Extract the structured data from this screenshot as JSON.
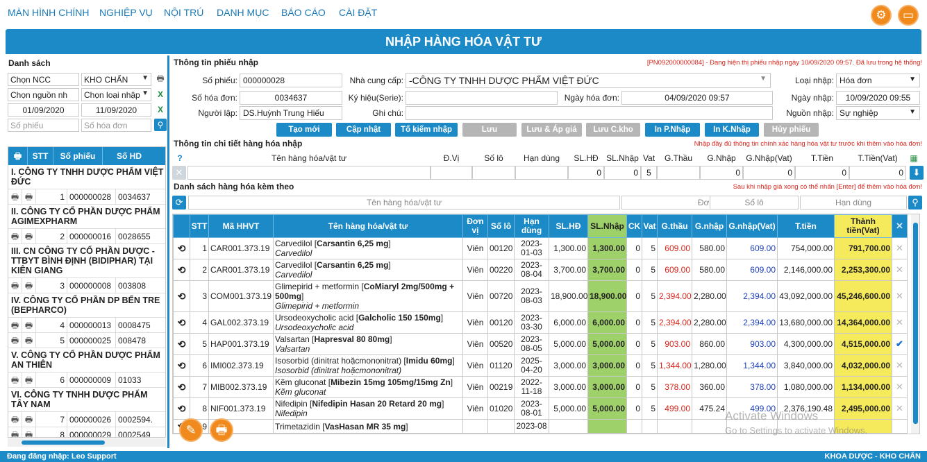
{
  "nav": {
    "items": [
      "MÀN HÌNH CHÍNH",
      "NGHIỆP VỤ",
      "NỘI TRÚ",
      "DANH MỤC",
      "BÁO CÁO",
      "CÀI ĐẶT"
    ]
  },
  "page_title": "NHẬP HÀNG HÓA VẬT TƯ",
  "left": {
    "heading": "Danh sách",
    "supplier_select": "Chọn NCC",
    "warehouse_select": "KHO CHẨN",
    "source_select": "Chọn nguồn nh",
    "import_type_select": "Chọn loại nhập",
    "date_from": "01/09/2020",
    "date_to": "11/09/2020",
    "receipt_no_placeholder": "Số phiếu",
    "invoice_no_placeholder": "Số hóa đơn",
    "columns": [
      "STT",
      "Số phiếu",
      "Số HD"
    ],
    "groups": [
      {
        "name": "I. CÔNG TY TNHH DƯỢC PHẨM VIỆT ĐỨC",
        "items": [
          {
            "stt": "1",
            "so_phieu": "000000028",
            "so_hd": "0034637"
          }
        ]
      },
      {
        "name": "II. CÔNG TY CỔ PHẦN DƯỢC PHẨM AGIMEXPHARM",
        "items": [
          {
            "stt": "2",
            "so_phieu": "000000016",
            "so_hd": "0028655"
          }
        ]
      },
      {
        "name": "III. CN CÔNG TY CỔ PHẦN DƯỢC - TTBYT BÌNH ĐỊNH (BIDIPHAR) TẠI KIÊN GIANG",
        "items": [
          {
            "stt": "3",
            "so_phieu": "000000008",
            "so_hd": "003808"
          }
        ]
      },
      {
        "name": "IV. CÔNG TY CỔ PHẦN DP BẾN TRE (BEPHARCO)",
        "items": [
          {
            "stt": "4",
            "so_phieu": "000000013",
            "so_hd": "0008475"
          },
          {
            "stt": "5",
            "so_phieu": "000000025",
            "so_hd": "008478"
          }
        ]
      },
      {
        "name": "V. CÔNG TY CỔ PHẦN DƯỢC PHẨM AN THIÊN",
        "items": [
          {
            "stt": "6",
            "so_phieu": "000000009",
            "so_hd": "01033"
          }
        ]
      },
      {
        "name": "VI. CÔNG TY TNHH DƯỢC PHẨM TÂY NAM",
        "items": [
          {
            "stt": "7",
            "so_phieu": "000000026",
            "so_hd": "0002594."
          },
          {
            "stt": "8",
            "so_phieu": "000000029",
            "so_hd": "0002549"
          }
        ]
      }
    ]
  },
  "receipt": {
    "section_title": "Thông tin phiếu nhập",
    "status_note": "[PN092000000084] - Đang hiện thị phiếu nhập ngày 10/09/2020 09:57. Đã lưu trong hệ thống!",
    "so_phieu_label": "Số phiếu:",
    "so_phieu": "000000028",
    "ncc_label": "Nhà cung cấp:",
    "ncc": "-CÔNG TY TNHH DƯỢC PHẨM VIỆT ĐỨC",
    "loai_nhap_label": "Loại nhập:",
    "loai_nhap": "Hóa đơn",
    "so_hoa_don_label": "Số hóa đơn:",
    "so_hoa_don": "0034637",
    "ky_hieu_label": "Ký hiệu(Serie):",
    "ky_hieu": "",
    "ngay_hoa_don_label": "Ngày hóa đơn:",
    "ngay_hoa_don": "04/09/2020 09:57",
    "ngay_nhap_label": "Ngày nhập:",
    "ngay_nhap": "10/09/2020 09:55",
    "nguoi_lap_label": "Người lập:",
    "nguoi_lap": "DS.Huỳnh Trung Hiếu",
    "ghi_chu_label": "Ghi chú:",
    "ghi_chu": "",
    "nguon_nhap_label": "Nguồn nhập:",
    "nguon_nhap": "Sự nghiệp"
  },
  "buttons": {
    "new": "Tạo mới",
    "update": "Cập nhật",
    "search_receipt": "Tố kiếm nhập",
    "save": "Lưu",
    "save_apply": "Lưu & Áp giá",
    "save_warehouse": "Lưu C.kho",
    "print_receipt": "In P.Nhập",
    "print_check": "In K.Nhập",
    "cancel_receipt": "Hủy phiếu"
  },
  "detail": {
    "section_title": "Thông tin chi tiết hàng hóa nhập",
    "note": "Nhập đầy đủ thông tin chính xác hàng hóa vật tư trước khi thêm vào hóa đơn!",
    "columns": [
      "Tên hàng hóa/vật tư",
      "Đ.Vị",
      "Số lô",
      "Hạn dùng",
      "SL.HĐ",
      "SL.Nhập",
      "Vat",
      "G.Thầu",
      "G.Nhập",
      "G.Nhập(Vat)",
      "T.Tiền",
      "T.Tiền(Vat)"
    ],
    "values": {
      "sl_hd": "0",
      "sl_nhap": "0",
      "vat": "5",
      "g_nhap": "0",
      "g_nhap_vat": "0",
      "t_tien": "0",
      "t_tien_vat": "0"
    }
  },
  "list": {
    "section_title": "Danh sách hàng hóa kèm theo",
    "note": "Sau khi nhập giá xong có thể nhấn [Enter] để thêm vào hóa đơn!",
    "filter_name": "Tên hàng hóa/vật tư",
    "filter_unit": "Đơn vị",
    "filter_lot": "Số lô",
    "filter_expiry": "Hạn dùng",
    "columns": [
      "STT",
      "Mã HHVT",
      "Tên hàng hóa/vật tư",
      "Đơn vị",
      "Số lô",
      "Hạn dùng",
      "SL.HĐ",
      "SL.Nhập",
      "CK",
      "Vat",
      "G.thầu",
      "G.nhập",
      "G.nhập(Vat)",
      "T.tiền",
      "Thành tiền(Vat)"
    ],
    "rows": [
      {
        "stt": "1",
        "ma": "CAR001.373.19",
        "ten": "Carvedilol",
        "brand": "Carsantin 6,25 mg",
        "generic": "Carvedilol",
        "dv": "Viên",
        "lo": "00120",
        "han": "2023-01-03",
        "sl_hd": "1,300.00",
        "sl_nhap": "1,300.00",
        "ck": "0",
        "vat": "5",
        "g_thau": "609.00",
        "g_nhap": "580.00",
        "g_nhap_vat": "609.00",
        "t_tien": "754,000.00",
        "thanh_tien": "791,700.00",
        "mark": "x"
      },
      {
        "stt": "2",
        "ma": "CAR001.373.19",
        "ten": "Carvedilol",
        "brand": "Carsantin 6,25 mg",
        "generic": "Carvedilol",
        "dv": "Viên",
        "lo": "00220",
        "han": "2023-08-04",
        "sl_hd": "3,700.00",
        "sl_nhap": "3,700.00",
        "ck": "0",
        "vat": "5",
        "g_thau": "609.00",
        "g_nhap": "580.00",
        "g_nhap_vat": "609.00",
        "t_tien": "2,146,000.00",
        "thanh_tien": "2,253,300.00",
        "mark": "x"
      },
      {
        "stt": "3",
        "ma": "COM001.373.19",
        "ten": "Glimepirid + metformin",
        "brand": "CoMiaryl 2mg/500mg + 500mg",
        "generic": "Glimepirid + metformin",
        "dv": "Viên",
        "lo": "00720",
        "han": "2023-08-03",
        "sl_hd": "18,900.00",
        "sl_nhap": "18,900.00",
        "ck": "0",
        "vat": "5",
        "g_thau": "2,394.00",
        "g_nhap": "2,280.00",
        "g_nhap_vat": "2,394.00",
        "t_tien": "43,092,000.00",
        "thanh_tien": "45,246,600.00",
        "mark": "x"
      },
      {
        "stt": "4",
        "ma": "GAL002.373.19",
        "ten": "Ursodeoxycholic acid",
        "brand": "Galcholic 150 150mg",
        "generic": "Ursodeoxycholic acid",
        "dv": "Viên",
        "lo": "00120",
        "han": "2023-03-30",
        "sl_hd": "6,000.00",
        "sl_nhap": "6,000.00",
        "ck": "0",
        "vat": "5",
        "g_thau": "2,394.00",
        "g_nhap": "2,280.00",
        "g_nhap_vat": "2,394.00",
        "t_tien": "13,680,000.00",
        "thanh_tien": "14,364,000.00",
        "mark": "x"
      },
      {
        "stt": "5",
        "ma": "HAP001.373.19",
        "ten": "Valsartan",
        "brand": "Hapresval 80 80mg",
        "generic": "Valsartan",
        "dv": "Viên",
        "lo": "00520",
        "han": "2023-08-05",
        "sl_hd": "5,000.00",
        "sl_nhap": "5,000.00",
        "ck": "0",
        "vat": "5",
        "g_thau": "903.00",
        "g_nhap": "860.00",
        "g_nhap_vat": "903.00",
        "t_tien": "4,300,000.00",
        "thanh_tien": "4,515,000.00",
        "mark": "check"
      },
      {
        "stt": "6",
        "ma": "IMI002.373.19",
        "ten": "Isosorbid (dinitrat hoặcmononitrat)",
        "brand": "Imidu 60mg",
        "generic": "Isosorbid (dinitrat hoặcmononitrat)",
        "dv": "Viên",
        "lo": "01120",
        "han": "2025-04-20",
        "sl_hd": "3,000.00",
        "sl_nhap": "3,000.00",
        "ck": "0",
        "vat": "5",
        "g_thau": "1,344.00",
        "g_nhap": "1,280.00",
        "g_nhap_vat": "1,344.00",
        "t_tien": "3,840,000.00",
        "thanh_tien": "4,032,000.00",
        "mark": "x"
      },
      {
        "stt": "7",
        "ma": "MIB002.373.19",
        "ten": "Kẽm gluconat",
        "brand": "Mibezin 15mg 105mg/15mg Zn",
        "generic": "Kẽm gluconat",
        "dv": "Viên",
        "lo": "00219",
        "han": "2022-11-18",
        "sl_hd": "3,000.00",
        "sl_nhap": "3,000.00",
        "ck": "0",
        "vat": "5",
        "g_thau": "378.00",
        "g_nhap": "360.00",
        "g_nhap_vat": "378.00",
        "t_tien": "1,080,000.00",
        "thanh_tien": "1,134,000.00",
        "mark": "x"
      },
      {
        "stt": "8",
        "ma": "NIF001.373.19",
        "ten": "Nifedipin",
        "brand": "Nifedipin Hasan 20 Retard 20 mg",
        "generic": "Nifedipin",
        "dv": "Viên",
        "lo": "01020",
        "han": "2023-08-01",
        "sl_hd": "5,000.00",
        "sl_nhap": "5,000.00",
        "ck": "0",
        "vat": "5",
        "g_thau": "499.00",
        "g_nhap": "475.24",
        "g_nhap_vat": "499.00",
        "t_tien": "2,376,190.48",
        "thanh_tien": "2,495,000.00",
        "mark": "x"
      },
      {
        "stt": "9",
        "ma": "",
        "ten": "Trimetazidin",
        "brand": "VasHasan MR 35 mg",
        "generic": "",
        "dv": "",
        "lo": "",
        "han": "2023-08",
        "sl_hd": "",
        "sl_nhap": "",
        "ck": "",
        "vat": "",
        "g_thau": "",
        "g_nhap": "",
        "g_nhap_vat": "",
        "t_tien": "",
        "thanh_tien": "",
        "mark": ""
      }
    ]
  },
  "watermark": {
    "line1": "Activate Windows",
    "line2": "Go to Settings to activate Windows."
  },
  "footer": {
    "login": "Đang đăng nhập: Leo Support",
    "dept": "KHOA DƯỢC - KHO CHẨN"
  }
}
